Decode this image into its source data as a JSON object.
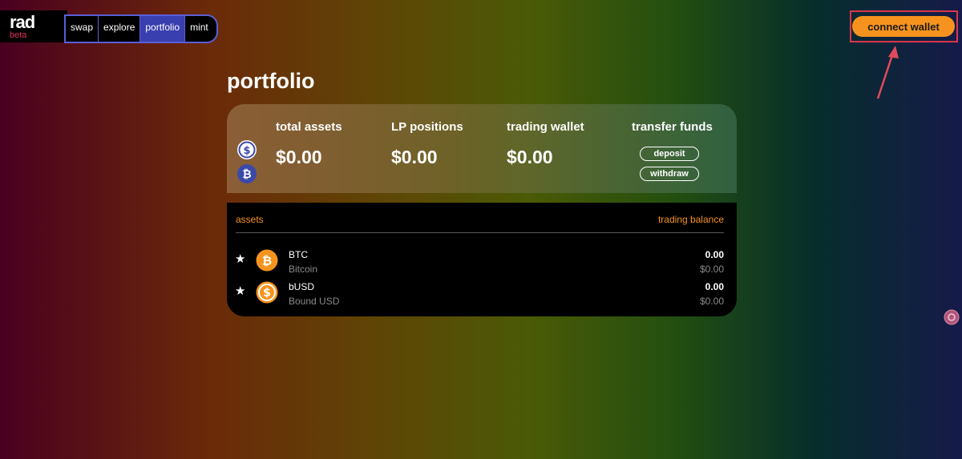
{
  "logo": {
    "text": "rad",
    "badge": "beta"
  },
  "nav": {
    "tabs": [
      "swap",
      "explore",
      "portfolio",
      "mint"
    ],
    "active": "portfolio"
  },
  "header": {
    "connect_label": "connect wallet"
  },
  "page": {
    "title": "portfolio"
  },
  "summary": {
    "total_assets": {
      "label": "total assets",
      "value": "$0.00"
    },
    "lp_positions": {
      "label": "LP positions",
      "value": "$0.00"
    },
    "trading_wallet": {
      "label": "trading wallet",
      "value": "$0.00"
    },
    "transfer_funds": {
      "label": "transfer funds",
      "deposit": "deposit",
      "withdraw": "withdraw"
    }
  },
  "assets": {
    "header_left": "assets",
    "header_right": "trading balance",
    "rows": [
      {
        "symbol": "BTC",
        "name": "Bitcoin",
        "balance": "0.00",
        "usd": "$0.00",
        "icon": "bitcoin-icon"
      },
      {
        "symbol": "bUSD",
        "name": "Bound USD",
        "balance": "0.00",
        "usd": "$0.00",
        "icon": "dollar-coin-icon"
      }
    ]
  },
  "colors": {
    "accent": "#f6931e",
    "nav_border": "#5a5fd6",
    "nav_active": "#3a3fb0",
    "annotation": "#d9374b"
  }
}
